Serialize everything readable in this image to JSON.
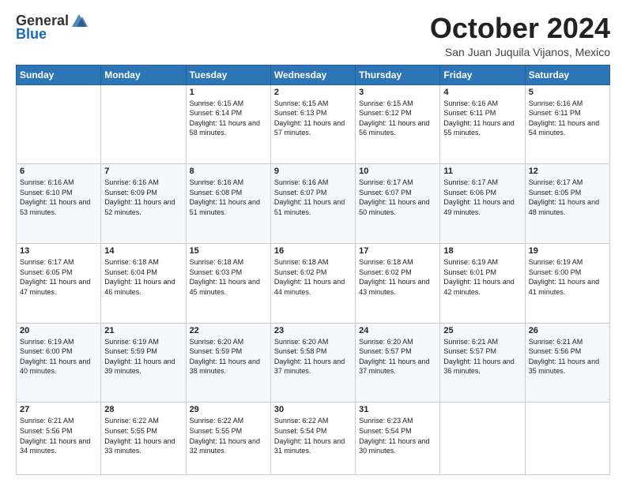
{
  "logo": {
    "general": "General",
    "blue": "Blue"
  },
  "header": {
    "month": "October 2024",
    "location": "San Juan Juquila Vijanos, Mexico"
  },
  "weekdays": [
    "Sunday",
    "Monday",
    "Tuesday",
    "Wednesday",
    "Thursday",
    "Friday",
    "Saturday"
  ],
  "weeks": [
    [
      {
        "day": "",
        "info": ""
      },
      {
        "day": "",
        "info": ""
      },
      {
        "day": "1",
        "info": "Sunrise: 6:15 AM\nSunset: 6:14 PM\nDaylight: 11 hours and 58 minutes."
      },
      {
        "day": "2",
        "info": "Sunrise: 6:15 AM\nSunset: 6:13 PM\nDaylight: 11 hours and 57 minutes."
      },
      {
        "day": "3",
        "info": "Sunrise: 6:15 AM\nSunset: 6:12 PM\nDaylight: 11 hours and 56 minutes."
      },
      {
        "day": "4",
        "info": "Sunrise: 6:16 AM\nSunset: 6:11 PM\nDaylight: 11 hours and 55 minutes."
      },
      {
        "day": "5",
        "info": "Sunrise: 6:16 AM\nSunset: 6:11 PM\nDaylight: 11 hours and 54 minutes."
      }
    ],
    [
      {
        "day": "6",
        "info": "Sunrise: 6:16 AM\nSunset: 6:10 PM\nDaylight: 11 hours and 53 minutes."
      },
      {
        "day": "7",
        "info": "Sunrise: 6:16 AM\nSunset: 6:09 PM\nDaylight: 11 hours and 52 minutes."
      },
      {
        "day": "8",
        "info": "Sunrise: 6:16 AM\nSunset: 6:08 PM\nDaylight: 11 hours and 51 minutes."
      },
      {
        "day": "9",
        "info": "Sunrise: 6:16 AM\nSunset: 6:07 PM\nDaylight: 11 hours and 51 minutes."
      },
      {
        "day": "10",
        "info": "Sunrise: 6:17 AM\nSunset: 6:07 PM\nDaylight: 11 hours and 50 minutes."
      },
      {
        "day": "11",
        "info": "Sunrise: 6:17 AM\nSunset: 6:06 PM\nDaylight: 11 hours and 49 minutes."
      },
      {
        "day": "12",
        "info": "Sunrise: 6:17 AM\nSunset: 6:05 PM\nDaylight: 11 hours and 48 minutes."
      }
    ],
    [
      {
        "day": "13",
        "info": "Sunrise: 6:17 AM\nSunset: 6:05 PM\nDaylight: 11 hours and 47 minutes."
      },
      {
        "day": "14",
        "info": "Sunrise: 6:18 AM\nSunset: 6:04 PM\nDaylight: 11 hours and 46 minutes."
      },
      {
        "day": "15",
        "info": "Sunrise: 6:18 AM\nSunset: 6:03 PM\nDaylight: 11 hours and 45 minutes."
      },
      {
        "day": "16",
        "info": "Sunrise: 6:18 AM\nSunset: 6:02 PM\nDaylight: 11 hours and 44 minutes."
      },
      {
        "day": "17",
        "info": "Sunrise: 6:18 AM\nSunset: 6:02 PM\nDaylight: 11 hours and 43 minutes."
      },
      {
        "day": "18",
        "info": "Sunrise: 6:19 AM\nSunset: 6:01 PM\nDaylight: 11 hours and 42 minutes."
      },
      {
        "day": "19",
        "info": "Sunrise: 6:19 AM\nSunset: 6:00 PM\nDaylight: 11 hours and 41 minutes."
      }
    ],
    [
      {
        "day": "20",
        "info": "Sunrise: 6:19 AM\nSunset: 6:00 PM\nDaylight: 11 hours and 40 minutes."
      },
      {
        "day": "21",
        "info": "Sunrise: 6:19 AM\nSunset: 5:59 PM\nDaylight: 11 hours and 39 minutes."
      },
      {
        "day": "22",
        "info": "Sunrise: 6:20 AM\nSunset: 5:59 PM\nDaylight: 11 hours and 38 minutes."
      },
      {
        "day": "23",
        "info": "Sunrise: 6:20 AM\nSunset: 5:58 PM\nDaylight: 11 hours and 37 minutes."
      },
      {
        "day": "24",
        "info": "Sunrise: 6:20 AM\nSunset: 5:57 PM\nDaylight: 11 hours and 37 minutes."
      },
      {
        "day": "25",
        "info": "Sunrise: 6:21 AM\nSunset: 5:57 PM\nDaylight: 11 hours and 36 minutes."
      },
      {
        "day": "26",
        "info": "Sunrise: 6:21 AM\nSunset: 5:56 PM\nDaylight: 11 hours and 35 minutes."
      }
    ],
    [
      {
        "day": "27",
        "info": "Sunrise: 6:21 AM\nSunset: 5:56 PM\nDaylight: 11 hours and 34 minutes."
      },
      {
        "day": "28",
        "info": "Sunrise: 6:22 AM\nSunset: 5:55 PM\nDaylight: 11 hours and 33 minutes."
      },
      {
        "day": "29",
        "info": "Sunrise: 6:22 AM\nSunset: 5:55 PM\nDaylight: 11 hours and 32 minutes."
      },
      {
        "day": "30",
        "info": "Sunrise: 6:22 AM\nSunset: 5:54 PM\nDaylight: 11 hours and 31 minutes."
      },
      {
        "day": "31",
        "info": "Sunrise: 6:23 AM\nSunset: 5:54 PM\nDaylight: 11 hours and 30 minutes."
      },
      {
        "day": "",
        "info": ""
      },
      {
        "day": "",
        "info": ""
      }
    ]
  ]
}
